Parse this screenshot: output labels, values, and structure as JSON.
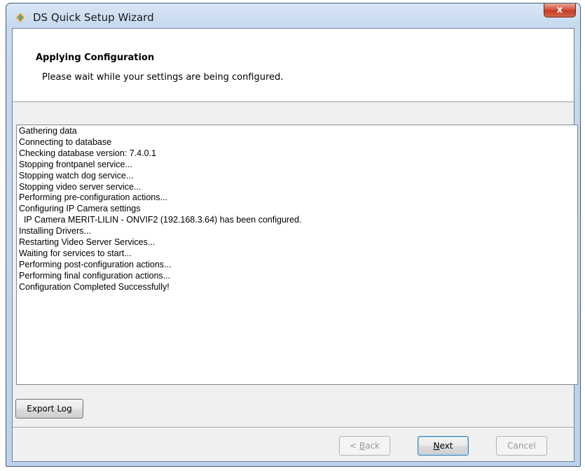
{
  "window": {
    "title": "DS Quick Setup Wizard",
    "close_label": "x"
  },
  "header": {
    "title": "Applying Configuration",
    "subtitle": "Please wait while your settings are being configured."
  },
  "log": {
    "lines": [
      "Gathering data",
      "Connecting to database",
      "Checking database version: 7.4.0.1",
      "Stopping frontpanel service...",
      "Stopping watch dog service...",
      "Stopping video server service...",
      "Performing pre-configuration actions...",
      "Configuring IP Camera settings",
      "  IP Camera MERIT-LILIN - ONVIF2 (192.168.3.64) has been configured.",
      "Installing Drivers...",
      "Restarting Video Server Services...",
      "Waiting for services to start...",
      "Performing post-configuration actions...",
      "Performing final configuration actions...",
      "Configuration Completed Successfully!"
    ]
  },
  "buttons": {
    "export_log": "Export Log",
    "back_prefix": "< ",
    "back_accel": "B",
    "back_rest": "ack",
    "next_accel": "N",
    "next_rest": "ext",
    "cancel": "Cancel"
  },
  "colors": {
    "title_bar": "#c7daf0",
    "close_button": "#c33a22",
    "client_bg": "#f0f0f0",
    "default_button_border": "#3c7fb1"
  }
}
